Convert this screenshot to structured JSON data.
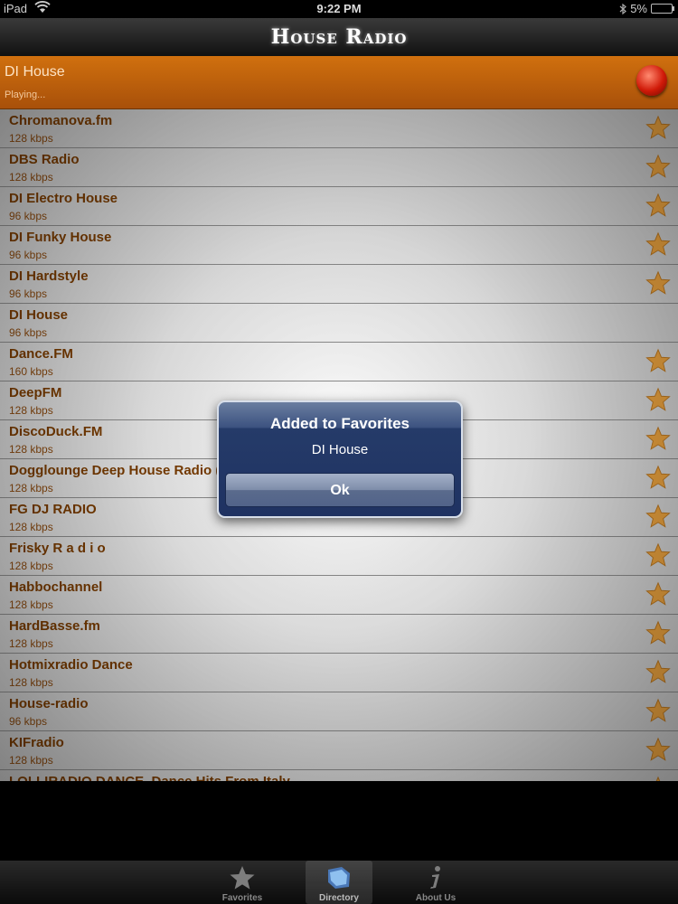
{
  "status": {
    "device": "iPad",
    "time": "9:22 PM",
    "battery": "5%",
    "battery_level": 0.05
  },
  "nav": {
    "title": "House Radio"
  },
  "now_playing": {
    "station": "DI House",
    "status": "Playing..."
  },
  "stations": [
    {
      "name": "Chromanova.fm",
      "bitrate": "128 kbps",
      "star": true
    },
    {
      "name": "DBS Radio",
      "bitrate": "128 kbps",
      "star": true
    },
    {
      "name": "DI Electro House",
      "bitrate": "96 kbps",
      "star": true
    },
    {
      "name": "DI Funky House",
      "bitrate": "96 kbps",
      "star": true
    },
    {
      "name": "DI Hardstyle",
      "bitrate": "96 kbps",
      "star": true
    },
    {
      "name": "DI House",
      "bitrate": "96 kbps",
      "star": false
    },
    {
      "name": "Dance.FM",
      "bitrate": "160 kbps",
      "star": true
    },
    {
      "name": "DeepFM",
      "bitrate": "128 kbps",
      "star": true
    },
    {
      "name": "DiscoDuck.FM",
      "bitrate": "128 kbps",
      "star": true
    },
    {
      "name": "Dogglounge Deep House Radio (MN)",
      "bitrate": "128 kbps",
      "star": true
    },
    {
      "name": "FG DJ RADIO",
      "bitrate": "128 kbps",
      "star": true
    },
    {
      "name": "Frisky R a d i o",
      "bitrate": "128 kbps",
      "star": true
    },
    {
      "name": "Habbochannel",
      "bitrate": "128 kbps",
      "star": true
    },
    {
      "name": "HardBasse.fm",
      "bitrate": "128 kbps",
      "star": true
    },
    {
      "name": "Hotmixradio Dance",
      "bitrate": "128 kbps",
      "star": true
    },
    {
      "name": "House-radio",
      "bitrate": "96 kbps",
      "star": true
    },
    {
      "name": "KIFradio",
      "bitrate": "128 kbps",
      "star": true
    },
    {
      "name": "LOLLIRADIO DANCE, Dance Hits From Italy",
      "bitrate": "",
      "star": true
    }
  ],
  "alert": {
    "title": "Added to Favorites",
    "message": "DI House",
    "button": "Ok"
  },
  "tabs": [
    {
      "label": "Favorites",
      "icon": "star-icon",
      "active": false
    },
    {
      "label": "Directory",
      "icon": "directory-icon",
      "active": true
    },
    {
      "label": "About Us",
      "icon": "info-icon",
      "active": false
    }
  ],
  "colors": {
    "now_playing_bg": "#c0620c",
    "station_text": "#7a3c00",
    "star": "#f0a640",
    "alert_bg": "#253b69"
  }
}
